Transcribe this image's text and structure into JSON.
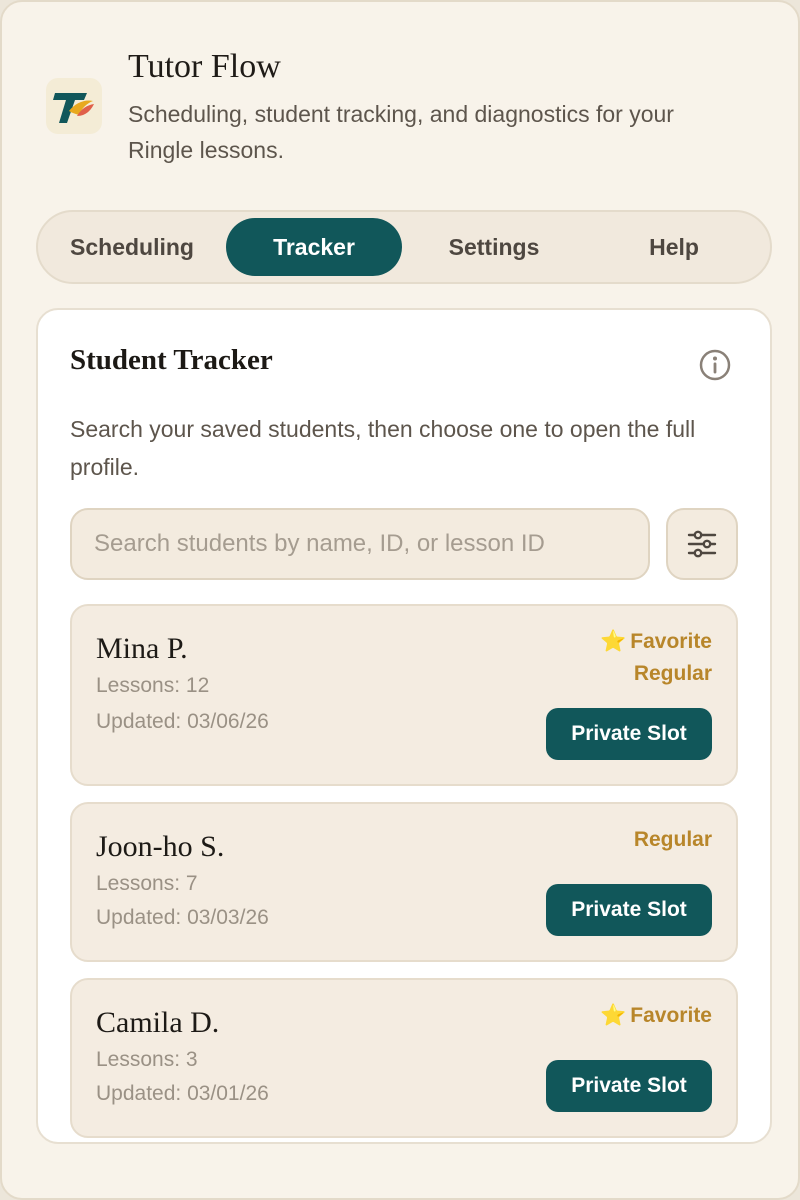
{
  "app": {
    "title": "Tutor Flow",
    "subtitle": "Scheduling, student tracking, and diagnostics for your Ringle lessons.",
    "logo_icon": "tutor-flow-logo"
  },
  "tabs": [
    {
      "label": "Scheduling",
      "active": false
    },
    {
      "label": "Tracker",
      "active": true
    },
    {
      "label": "Settings",
      "active": false
    },
    {
      "label": "Help",
      "active": false
    }
  ],
  "tracker": {
    "title": "Student Tracker",
    "description": "Search your saved students, then choose one to open the full profile.",
    "info_icon": "info-icon",
    "search": {
      "value": "",
      "placeholder": "Search students by name, ID, or lesson ID"
    },
    "filter_icon": "sliders-icon",
    "students": [
      {
        "name": "Mina P.",
        "lessons": "Lessons: 12",
        "updated": "Updated: 03/06/26",
        "favorite": "Favorite",
        "regular": "Regular",
        "action": "Private Slot"
      },
      {
        "name": "Joon-ho S.",
        "lessons": "Lessons: 7",
        "updated": "Updated: 03/03/26",
        "favorite": "",
        "regular": "Regular",
        "action": "Private Slot"
      },
      {
        "name": "Camila D.",
        "lessons": "Lessons: 3",
        "updated": "Updated: 03/01/26",
        "favorite": "Favorite",
        "regular": "",
        "action": "Private Slot"
      }
    ]
  },
  "colors": {
    "primary": "#11575a",
    "background": "#f8f3ea",
    "card_row": "#f4ece1",
    "badge": "#b8862a",
    "star": "#f2b01e"
  }
}
